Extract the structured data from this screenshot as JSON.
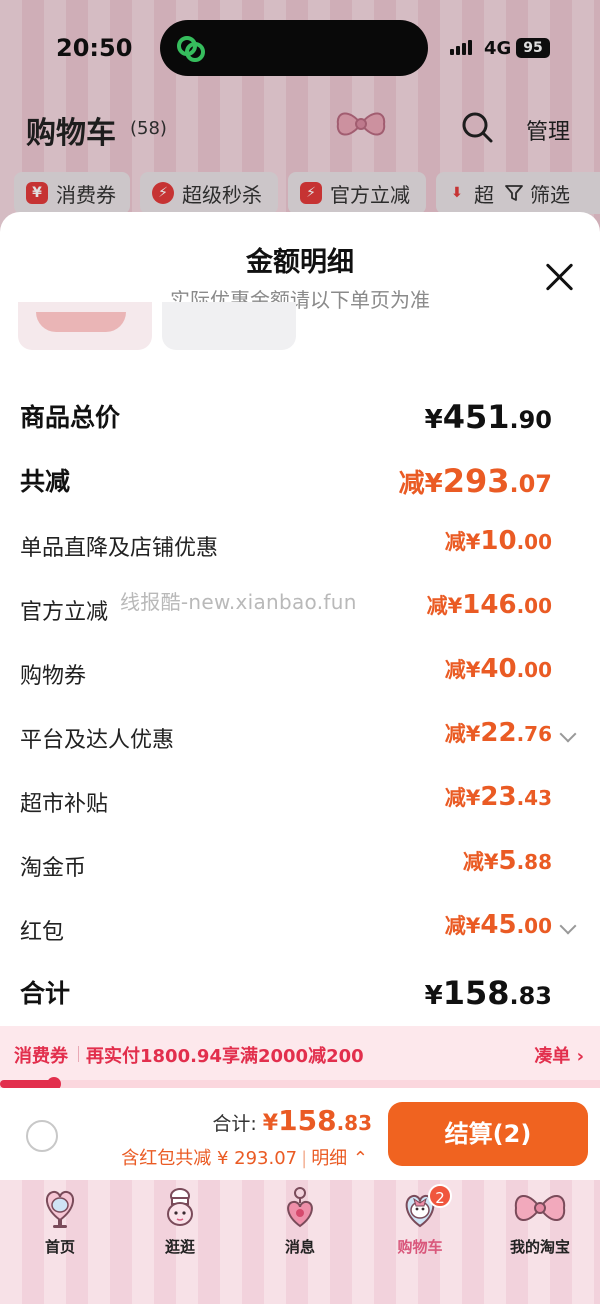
{
  "status_bar": {
    "time": "20:50",
    "network": "4G",
    "battery": "95"
  },
  "cart": {
    "title": "购物车",
    "count": "(58)",
    "manage_label": "管理"
  },
  "filters": [
    {
      "label": "消费券",
      "icon": "yen-coupon-icon"
    },
    {
      "label": "超级秒杀",
      "icon": "lightning-icon"
    },
    {
      "label": "官方立减",
      "icon": "lightning-badge-icon"
    },
    {
      "label": "超",
      "icon": "down-arrow-icon"
    }
  ],
  "filter_button": "筛选",
  "sheet": {
    "title": "金额明细",
    "subtitle": "实际优惠金额请以下单页为准",
    "rows": [
      {
        "label": "商品总价",
        "prefix": "¥",
        "int": "451",
        "dec": ".90"
      },
      {
        "label": "共减",
        "prefix": "减¥",
        "int": "293",
        "dec": ".07"
      },
      {
        "label": "单品直降及店铺优惠",
        "prefix": "减¥",
        "int": "10",
        "dec": ".00"
      },
      {
        "label": "官方立减",
        "prefix": "减¥",
        "int": "146",
        "dec": ".00"
      },
      {
        "label": "购物券",
        "prefix": "减¥",
        "int": "40",
        "dec": ".00"
      },
      {
        "label": "平台及达人优惠",
        "prefix": "减¥",
        "int": "22",
        "dec": ".76"
      },
      {
        "label": "超市补贴",
        "prefix": "减¥",
        "int": "23",
        "dec": ".43"
      },
      {
        "label": "淘金币",
        "prefix": "减¥",
        "int": "5",
        "dec": ".88"
      },
      {
        "label": "红包",
        "prefix": "减¥",
        "int": "45",
        "dec": ".00"
      },
      {
        "label": "合计",
        "prefix": "¥",
        "int": "158",
        "dec": ".83"
      }
    ],
    "watermark": "线报酷-new.xianbao.fun"
  },
  "coupon_bar": {
    "tag": "消费券",
    "text": "再实付1800.94享满2000减200",
    "link": "凑单 ›",
    "progress": 0.09
  },
  "checkout": {
    "total_label": "合计: ",
    "total_prefix": "¥",
    "total_int": "158",
    "total_dec": ".83",
    "subtext": "含红包共减 ¥ 293.07",
    "detail_link": "明细 ⌃",
    "pay_button": "结算(2)"
  },
  "tabbar": [
    {
      "label": "首页",
      "icon": "mirror-heart-icon"
    },
    {
      "label": "逛逛",
      "icon": "bunny-chef-icon"
    },
    {
      "label": "消息",
      "icon": "heart-keychain-icon"
    },
    {
      "label": "购物车",
      "icon": "cart-character-icon",
      "badge": "2",
      "active": true
    },
    {
      "label": "我的淘宝",
      "icon": "bow-icon"
    }
  ],
  "colors": {
    "accent": "#ea5b24",
    "pay_button": "#f06320",
    "coupon_red": "#e22f4d",
    "active_tab": "#d9577b"
  }
}
